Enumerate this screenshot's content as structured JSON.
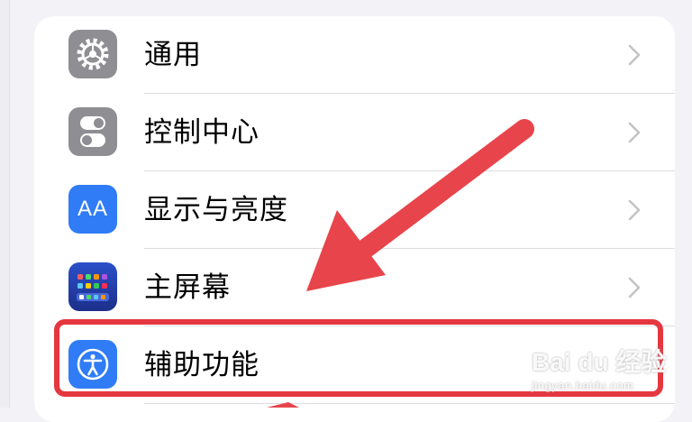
{
  "settings_items": [
    {
      "label": "通用",
      "icon": "gear-icon"
    },
    {
      "label": "控制中心",
      "icon": "toggles-icon"
    },
    {
      "label": "显示与亮度",
      "icon": "text-size-icon",
      "icon_text": "AA"
    },
    {
      "label": "主屏幕",
      "icon": "home-screen-icon"
    },
    {
      "label": "辅助功能",
      "icon": "accessibility-icon"
    }
  ],
  "watermark": {
    "main": "Bai du 经验",
    "sub": "jingyan.baidu.com"
  },
  "colors": {
    "highlight": "#e5373f",
    "accent_blue": "#2f7cf6",
    "icon_gray": "#8e8e93"
  }
}
